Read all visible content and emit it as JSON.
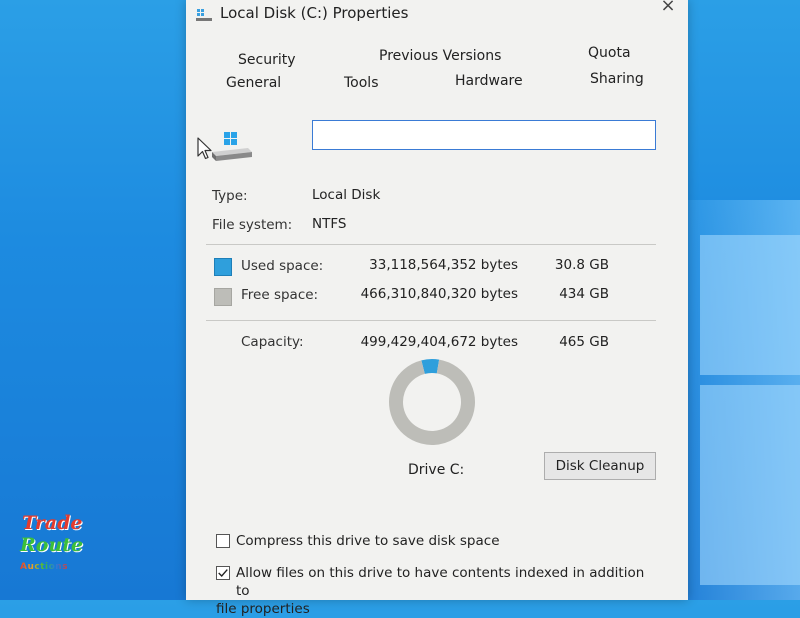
{
  "window": {
    "title": "Local Disk (C:) Properties",
    "close_label": "×"
  },
  "tabs": {
    "row1": [
      "Security",
      "Previous Versions",
      "Quota"
    ],
    "row2": [
      "General",
      "Tools",
      "Hardware",
      "Sharing"
    ]
  },
  "drive_name_input": {
    "value": ""
  },
  "info": {
    "type_label": "Type:",
    "type_value": "Local Disk",
    "fs_label": "File system:",
    "fs_value": "NTFS"
  },
  "space": {
    "used_label": "Used space:",
    "used_bytes": "33,118,564,352 bytes",
    "used_gb": "30.8 GB",
    "free_label": "Free space:",
    "free_bytes": "466,310,840,320 bytes",
    "free_gb": "434 GB",
    "capacity_label": "Capacity:",
    "capacity_bytes": "499,429,404,672 bytes",
    "capacity_gb": "465 GB"
  },
  "chart_data": {
    "type": "pie",
    "categories": [
      "Used space",
      "Free space"
    ],
    "values": [
      33118564352,
      466310840320
    ]
  },
  "drive_label": "Drive C:",
  "buttons": {
    "disk_cleanup": "Disk Cleanup"
  },
  "options": {
    "compress_label": "Compress this drive to save disk space",
    "compress_checked": false,
    "index_label_line1": "Allow files on this drive to have contents indexed in addition to",
    "index_label_line2": "file properties",
    "index_checked": true
  },
  "colors": {
    "used": "#2f9fdc",
    "free": "#bdbdb8",
    "desktop": "#1d8be0",
    "accent": "#3a7bd5"
  },
  "icons": {
    "title": "drive-icon",
    "drive": "windows-drive-icon",
    "cursor": "mouse-pointer-icon"
  },
  "watermark": {
    "line1": "Trade",
    "line2": "Route",
    "line3": "Auctions"
  }
}
